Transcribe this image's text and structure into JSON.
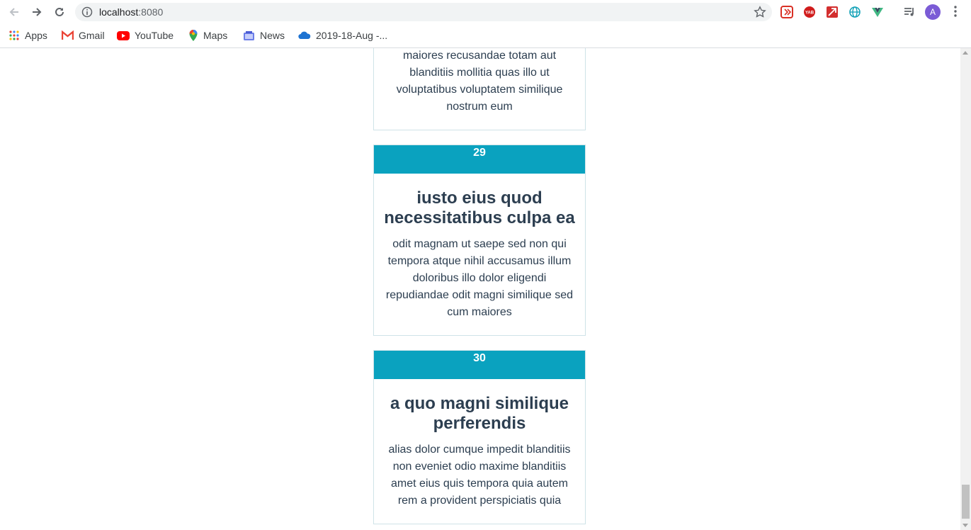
{
  "browser": {
    "url_host": "localhost",
    "url_port": ":8080",
    "avatar_letter": "A"
  },
  "bookmarks": [
    {
      "label": "Apps",
      "icon": "apps-grid-icon"
    },
    {
      "label": "Gmail",
      "icon": "gmail-icon"
    },
    {
      "label": "YouTube",
      "icon": "youtube-icon"
    },
    {
      "label": "Maps",
      "icon": "maps-pin-icon"
    },
    {
      "label": "News",
      "icon": "news-icon"
    },
    {
      "label": "2019-18-Aug -...",
      "icon": "onedrive-cloud-icon"
    }
  ],
  "cards": [
    {
      "id": "",
      "title": "",
      "body": "maiores recusandae totam aut blanditiis mollitia quas illo ut voluptatibus voluptatem similique nostrum eum"
    },
    {
      "id": "29",
      "title": "iusto eius quod necessitatibus culpa ea",
      "body": "odit magnam ut saepe sed non qui tempora atque nihil accusamus illum doloribus illo dolor eligendi repudiandae odit magni similique sed cum maiores"
    },
    {
      "id": "30",
      "title": "a quo magni similique perferendis",
      "body": "alias dolor cumque impedit blanditiis non eveniet odio maxime blanditiis amet eius quis tempora quia autem rem a provident perspiciatis quia"
    }
  ],
  "colors": {
    "card_header": "#0aa2bf",
    "text": "#2c3e50"
  }
}
